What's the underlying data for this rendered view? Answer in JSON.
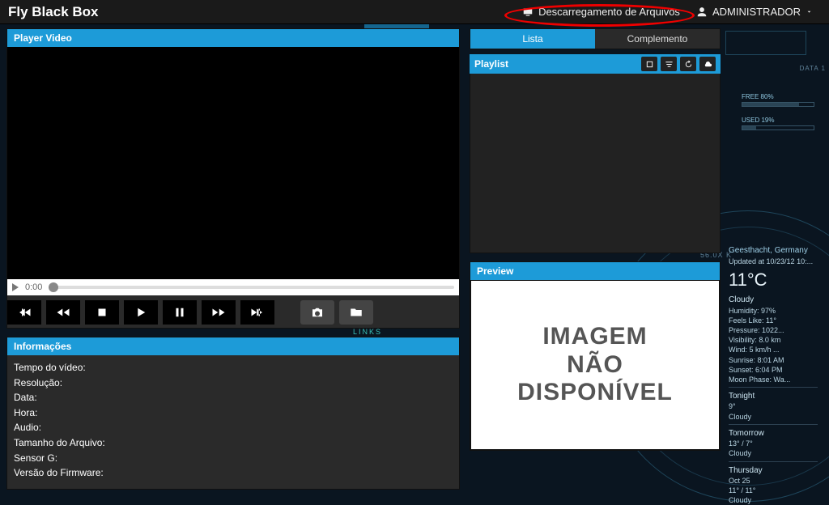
{
  "header": {
    "brand": "Fly Black Box",
    "download_label": "Descarregamento de Arquivos",
    "user_label": "ADMINISTRADOR"
  },
  "player": {
    "title": "Player Video",
    "time": "0:00"
  },
  "info": {
    "title": "Informações",
    "rows": {
      "tempo": "Tempo do vídeo:",
      "resolucao": "Resolução:",
      "data": "Data:",
      "hora": "Hora:",
      "audio": "Audio:",
      "tamanho": "Tamanho do Arquivo:",
      "sensor": "Sensor G:",
      "firmware": "Versão do Firmware:"
    }
  },
  "tabs": {
    "lista": "Lista",
    "complemento": "Complemento"
  },
  "playlist": {
    "title": "Playlist"
  },
  "preview": {
    "title": "Preview",
    "text_l1": "IMAGEM",
    "text_l2": "NÃO",
    "text_l3": "DISPONÍVEL"
  },
  "weather": {
    "city": "Geesthacht, Germany",
    "updated": "Updated at 10/23/12 10:...",
    "temp": "11°C",
    "cond": "Cloudy",
    "humidity": "Humidity: 97%",
    "feels": "Feels Like: 11°",
    "pressure": "Pressure: 1022...",
    "visibility": "Visibility: 8.0 km",
    "wind": "Wind: 5 km/h ...",
    "sunrise": "Sunrise: 8:01 AM",
    "sunset": "Sunset: 6:04 PM",
    "moon": "Moon Phase: Wa...",
    "tonight_lbl": "Tonight",
    "tonight_t": "9°",
    "tonight_c": "Cloudy",
    "tomorrow_lbl": "Tomorrow",
    "tomorrow_t": "13° / 7°",
    "tomorrow_c": "Cloudy",
    "thursday_lbl": "Thursday",
    "thursday_d": "Oct 25",
    "thursday_t": "11° / 11°",
    "thursday_c": "Cloudy"
  },
  "deco": {
    "free": "FREE   80%",
    "used": "USED  19%",
    "links": "LINKS",
    "data": "DATA 1",
    "fifty": "56.0X K"
  }
}
